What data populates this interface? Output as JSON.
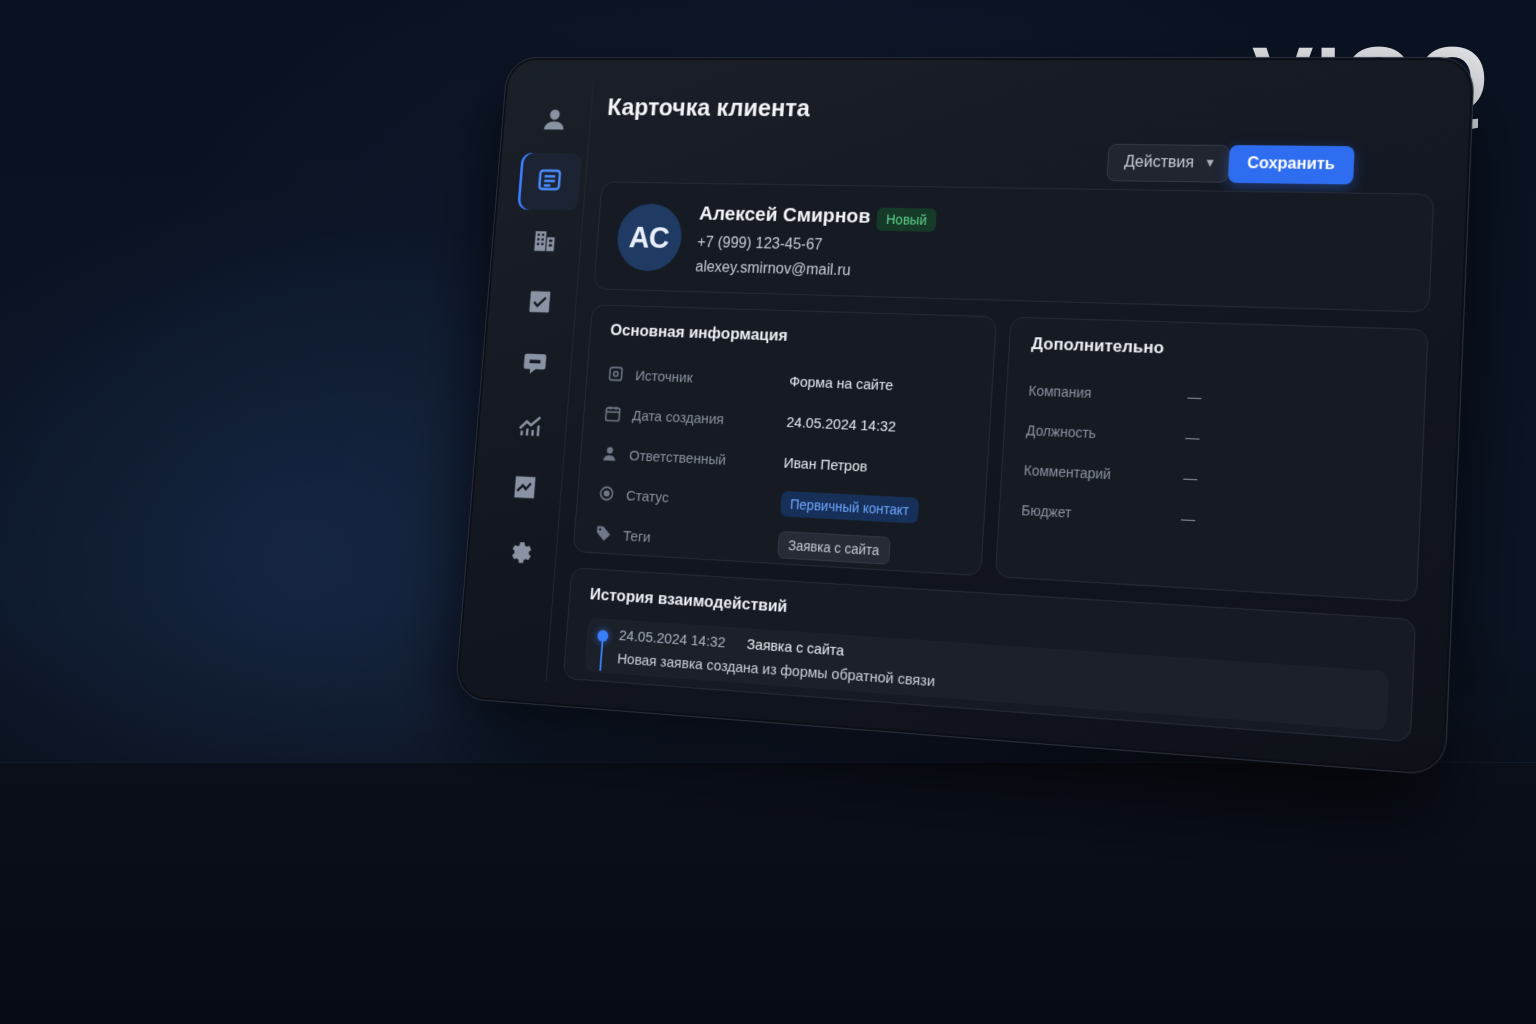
{
  "brand": {
    "logo_text": "VIQQ"
  },
  "sidebar": {
    "items": [
      {
        "icon": "user-icon",
        "active": false
      },
      {
        "icon": "card-icon",
        "active": true
      },
      {
        "icon": "building-icon",
        "active": false
      },
      {
        "icon": "checkbox-icon",
        "active": false
      },
      {
        "icon": "chat-icon",
        "active": false
      },
      {
        "icon": "trend-chart-icon",
        "active": false
      },
      {
        "icon": "analytics-icon",
        "active": false
      },
      {
        "icon": "gear-icon",
        "active": false
      }
    ]
  },
  "header": {
    "title": "Карточка клиента",
    "actions_label": "Действия",
    "save_label": "Сохранить"
  },
  "client": {
    "initials": "АС",
    "name": "Алексей Смирнов",
    "status_badge": "Новый",
    "phone": "+7 (999) 123-45-67",
    "email": "alexey.smirnov@mail.ru"
  },
  "basic_info": {
    "title": "Основная информация",
    "rows": [
      {
        "label": "Источник",
        "value": "Форма на сайте"
      },
      {
        "label": "Дата создания",
        "value": "24.05.2024 14:32"
      },
      {
        "label": "Ответственный",
        "value": "Иван Петров"
      },
      {
        "label": "Статус",
        "value": "Первичный контакт"
      },
      {
        "label": "Теги",
        "value": "Заявка с сайта"
      }
    ]
  },
  "additional": {
    "title": "Дополнительно",
    "rows": [
      {
        "label": "Компания",
        "value": "—"
      },
      {
        "label": "Должность",
        "value": "—"
      },
      {
        "label": "Комментарий",
        "value": "—"
      },
      {
        "label": "Бюджет",
        "value": "—"
      }
    ]
  },
  "history": {
    "title": "История взаимодействий",
    "events": [
      {
        "date": "24.05.2024 14:32",
        "title": "Заявка с сайта",
        "description": "Новая заявка создана из формы обратной связи"
      }
    ]
  },
  "colors": {
    "accent": "#2f6df0",
    "badge_new": "#5fd28e",
    "status_pill": "#6ea7ff"
  }
}
